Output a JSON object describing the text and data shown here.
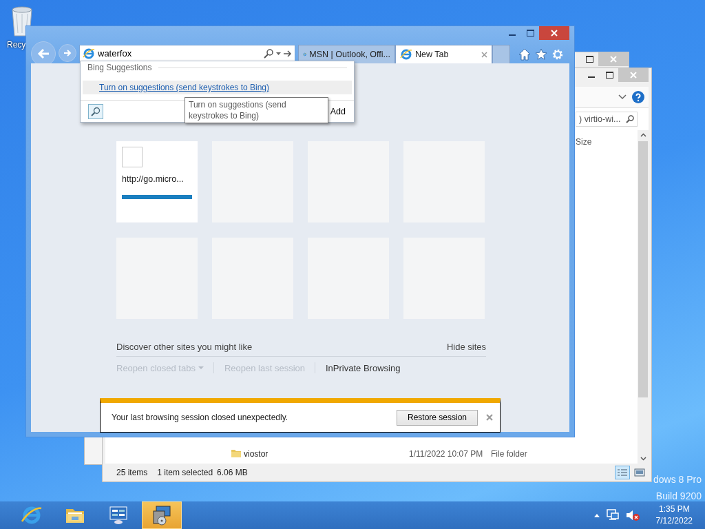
{
  "desktop": {
    "icons": [
      {
        "label": "Recy"
      }
    ],
    "edition": [
      "dows 8 Pro",
      "Build 9200"
    ]
  },
  "explorer": {
    "search": {
      "value": ") virtio-wi..."
    },
    "columns": [
      "Size"
    ],
    "rows": [
      {
        "name": "viostor",
        "date": "1/11/2022 10:07 PM",
        "type": "File folder"
      }
    ],
    "status": {
      "count": "25 items",
      "selection": "1 item selected",
      "size": "6.06 MB"
    },
    "views": [
      {
        "kind": "details",
        "selected": true
      },
      {
        "kind": "large-icons",
        "selected": false
      }
    ]
  },
  "ie": {
    "address": {
      "value": "waterfox"
    },
    "tabs": [
      {
        "label": "MSN | Outlook, Offi...",
        "selected": false
      },
      {
        "label": "New Tab",
        "selected": true
      }
    ],
    "suggestions": {
      "header": "Bing Suggestions",
      "link": "Turn on suggestions (send keystrokes to Bing)",
      "footer_action": "Add"
    },
    "tooltip": "Turn on suggestions (send keystrokes to Bing)",
    "tiles": [
      {
        "kind": "site",
        "label": "http://go.micro..."
      },
      {
        "kind": "empty"
      },
      {
        "kind": "empty"
      },
      {
        "kind": "empty"
      },
      {
        "kind": "empty"
      },
      {
        "kind": "empty"
      },
      {
        "kind": "empty"
      },
      {
        "kind": "empty"
      }
    ],
    "discover": {
      "text": "Discover other sites you might like",
      "hide": "Hide sites"
    },
    "actions": [
      {
        "label": "Reopen closed tabs",
        "disabled": true,
        "menu": true
      },
      {
        "label": "Reopen last session",
        "disabled": true,
        "menu": false
      },
      {
        "label": "InPrivate Browsing",
        "disabled": false,
        "menu": false
      }
    ],
    "notification": {
      "message": "Your last browsing session closed unexpectedly.",
      "button": "Restore session"
    }
  },
  "taskbar": {
    "items": [
      {
        "kind": "ie",
        "selected": false
      },
      {
        "kind": "explorer",
        "selected": false
      },
      {
        "kind": "control-panel",
        "selected": false
      },
      {
        "kind": "setup",
        "selected": true
      }
    ],
    "clock": {
      "time": "1:35 PM",
      "date": "7/12/2022"
    }
  }
}
